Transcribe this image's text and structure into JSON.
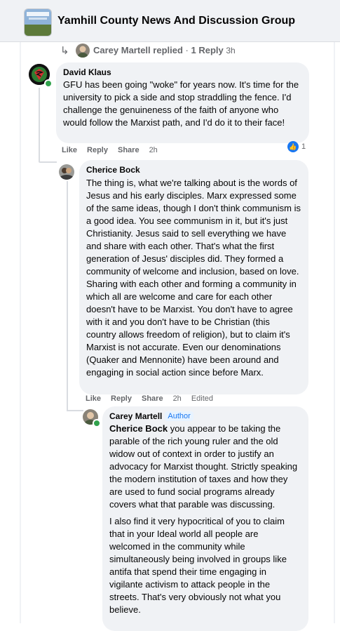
{
  "header": {
    "group_title": "Yamhill County News And Discussion Group"
  },
  "reply_summary": {
    "name": "Carey Martell",
    "action": "replied",
    "separator": "·",
    "count": "1 Reply",
    "time": "3h"
  },
  "comments": [
    {
      "author": "David Klaus",
      "text": "GFU has been going \"woke\" for years now. It's time for the university to pick a side and stop straddling the fence. I'd challenge the genuineness of the faith of anyone who would follow the Marxist path, and I'd do it to their face!",
      "actions": {
        "like": "Like",
        "reply": "Reply",
        "share": "Share",
        "time": "2h"
      },
      "reactions": "1"
    },
    {
      "author": "Cherice Bock",
      "text": "The thing is, what we're talking about is the words of Jesus and his early disciples. Marx expressed some of the same ideas, though I don't think communism is a good idea. You see communism in it, but it's just Christianity. Jesus said to sell everything we have and share with each other. That's what the first generation of Jesus' disciples did. They formed a community of welcome and inclusion, based on love. Sharing with each other and forming a community in which all are welcome and care for each other doesn't have to be Marxist. You don't have to agree with it and you don't have to be Christian (this country allows freedom of religion), but to claim it's Marxist is not accurate. Even our denominations (Quaker and Mennonite) have been around and engaging in social action since before Marx.",
      "actions": {
        "like": "Like",
        "reply": "Reply",
        "share": "Share",
        "time": "2h",
        "edited": "Edited"
      }
    },
    {
      "author": "Carey Martell",
      "badge": "Author",
      "mention": "Cherice Bock",
      "text_after_mention": " you appear to be taking the parable of the rich young ruler and the old widow out of context in order to justify an advocacy for Marxist thought. Strictly speaking the modern institution of taxes and how they are used to fund social programs already covers what that parable was discussing.",
      "text_para2": "I also find it very hypocritical of you to claim that in your Ideal world all people are welcomed in the community while simultaneously being involved in groups like antifa that spend their time engaging in vigilante activism to attack people in the streets. That's very obviously not what you believe."
    }
  ],
  "colors": {
    "bubble": "#f0f2f5",
    "link": "#1877f2",
    "online": "#31a24c",
    "meta_text": "#65676b"
  },
  "icons": [
    "group-thumbnail-icon",
    "reply-arrow-icon",
    "like-reaction-icon"
  ]
}
